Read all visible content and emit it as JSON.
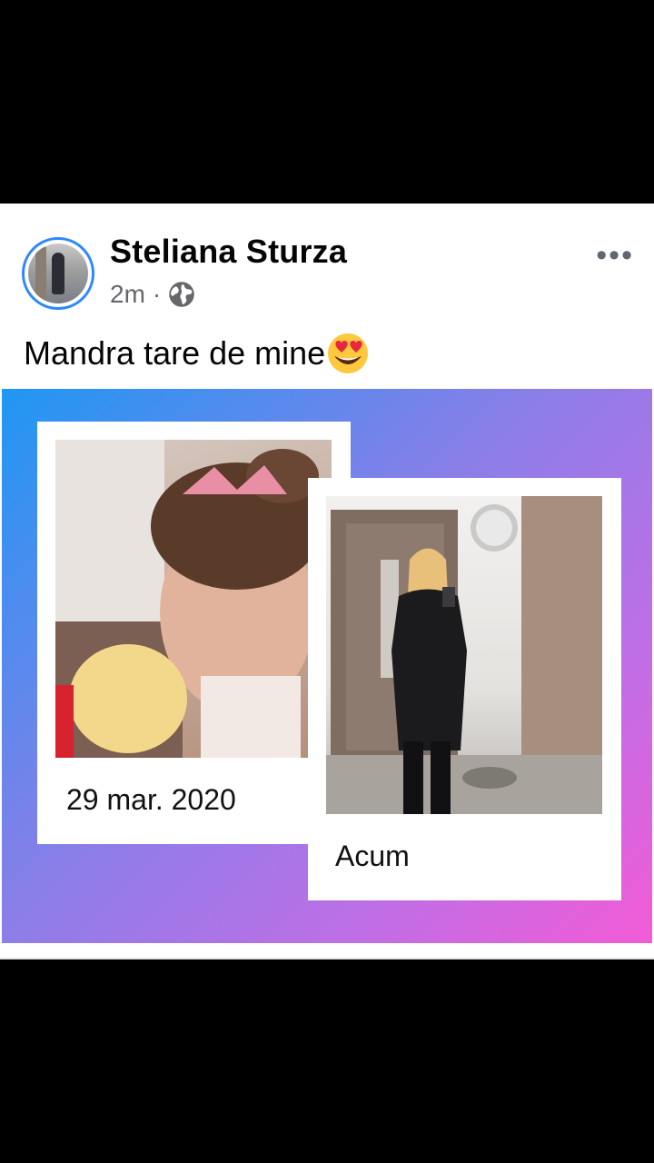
{
  "post": {
    "author": "Steliana Sturza",
    "timestamp": "2m",
    "separator": "·",
    "audience_icon": "globe-icon",
    "more_icon": "more-options-icon",
    "more_label": "•••",
    "caption": "Mandra tare de mine",
    "caption_emoji": "heart-eyes-emoji"
  },
  "image": {
    "left_card": {
      "label": "29 mar. 2020"
    },
    "right_card": {
      "label": "Acum"
    },
    "colors": {
      "gradient_start": "#1f97f3",
      "gradient_mid": "#8b7ee8",
      "gradient_end": "#f35bd6"
    }
  },
  "colors": {
    "accent": "#2d88ff",
    "meta_text": "#65676b",
    "primary_text": "#050505"
  }
}
